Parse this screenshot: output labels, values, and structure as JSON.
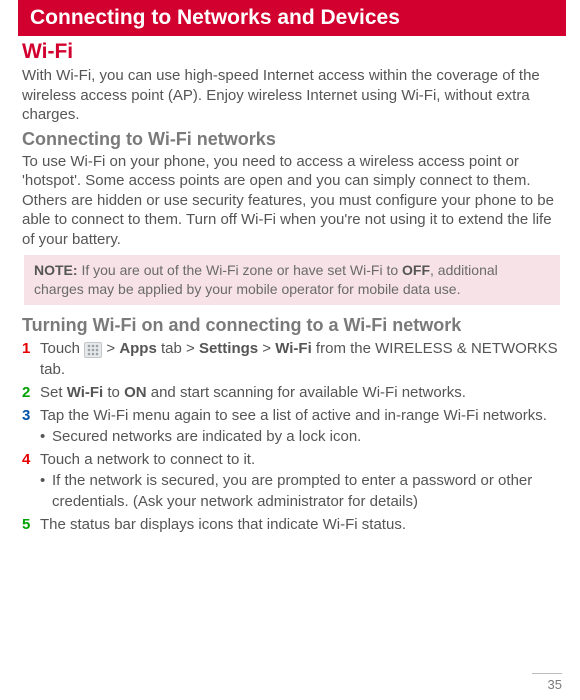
{
  "header": "Connecting to Networks and Devices",
  "section": {
    "title": "Wi-Fi",
    "intro": "With Wi-Fi, you can use high-speed Internet access within the coverage of the wireless access point (AP). Enjoy wireless Internet using Wi-Fi, without extra charges."
  },
  "connecting": {
    "title": "Connecting to Wi-Fi networks",
    "body": "To use Wi-Fi on your phone, you need to access a wireless access point or 'hotspot'. Some access points are open and you can simply connect to them. Others are hidden or use security features, you must configure your phone to be able to connect to them. Turn off Wi-Fi when you're not using it to extend the life of your battery."
  },
  "note": {
    "label": "NOTE:",
    "text_a": " If you are out of the Wi-Fi zone or have set Wi-Fi to ",
    "bold": "OFF",
    "text_b": ", additional charges may be applied by your mobile operator for mobile data use."
  },
  "turning": {
    "title": "Turning Wi-Fi on and connecting to a Wi-Fi network"
  },
  "steps": {
    "s1": {
      "pre": "Touch ",
      "icon": "apps-grid-icon",
      "gt1": " > ",
      "b1": "Apps",
      "mid1": " tab > ",
      "b2": "Settings",
      "gt2": " > ",
      "b3": "Wi-Fi",
      "post": " from the WIRELESS & NETWORKS tab."
    },
    "s2": {
      "pre": "Set ",
      "b1": "Wi-Fi",
      "mid": " to ",
      "b2": "ON",
      "post": " and start scanning for available Wi-Fi networks."
    },
    "s3": {
      "text": "Tap the Wi-Fi menu again to see a list of active and in-range Wi-Fi networks.",
      "bullet": "Secured networks are indicated by a lock icon."
    },
    "s4": {
      "text": "Touch a network to connect to it.",
      "bullet": "If the network is secured, you are prompted to enter a password or other credentials. (Ask your network administrator for details)"
    },
    "s5": {
      "text": "The status bar displays icons that indicate Wi-Fi status."
    }
  },
  "page": "35"
}
